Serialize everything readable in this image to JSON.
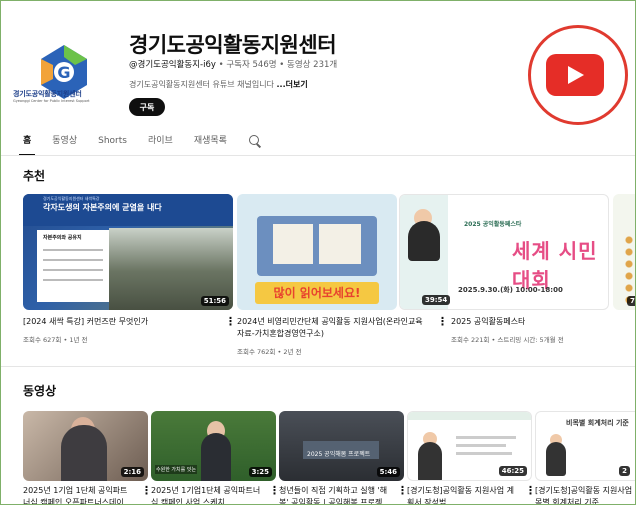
{
  "channel": {
    "logo_label": "경기도공익활동지원센터",
    "logo_sub": "Gyeonggi Center for Public Interest Support",
    "title": "경기도공익활동지원센터",
    "handle": "@경기도공익활동지-i6y",
    "subscribers": "구독자 546명",
    "videos": "동영상 231개",
    "description": "경기도공익활동지원센터 유튜브 채널입니다",
    "more_label": "...더보기",
    "subscribe_label": "구독"
  },
  "tabs": [
    {
      "label": "홈",
      "active": true
    },
    {
      "label": "동영상"
    },
    {
      "label": "Shorts"
    },
    {
      "label": "라이브"
    },
    {
      "label": "재생목록"
    }
  ],
  "recommended": {
    "title": "추천",
    "videos": [
      {
        "title": "[2024 새싹 특강] 커먼즈란 무엇인가",
        "meta": "조회수 627회 • 1년 전",
        "duration": "51:56",
        "thumb_text": "각자도생의 자본주의에 균열을 내다",
        "slide_text": "자본주의와 공유지"
      },
      {
        "title": "2024년 비영리민간단체 공익활동 지원사업(온라인교육",
        "title2": "자료-가치혼합경영연구소)",
        "meta": "조회수 762회 • 2년 전",
        "duration": "",
        "thumb_text": "많이 읽어보세요!"
      },
      {
        "title": "2025 공익활동페스타",
        "meta": "조회수 221회 • 스트리밍 시간: 5개월 전",
        "duration": "39:54",
        "thumb_text": "세계 시민대회",
        "thumb_date": "2025.9.30.(화) 10:00-18:00",
        "thumb_small": "2025 공익활동페스타"
      },
      {
        "title": "",
        "meta": "",
        "duration": "7:"
      }
    ]
  },
  "videos_section": {
    "title": "동영상",
    "videos": [
      {
        "title": "2025년 1기업 1단체 공익파트",
        "title2": "너십 캠페인 오픈파트너스데이...",
        "duration": "2:16"
      },
      {
        "title": "2025년 1기업1단체 공익파트너",
        "title2": "십 캠페인 사업 스케치",
        "duration": "3:25",
        "caption": "수원한 가치를 잇는"
      },
      {
        "title": "청년들이 직접 기획하고 실행 '해",
        "title2": "봄' 공익활동 | 공익해봄 프로젝...",
        "duration": "5:46",
        "caption": "2025 공익해봄 프로젝트"
      },
      {
        "title": "[경기도청]공익활동 지원사업 계",
        "title2": "획서 작성법",
        "duration": "46:25"
      },
      {
        "title": "[경기도청]공익활동 지원사업 비",
        "title2": "목별 회계처리 기준",
        "duration": "2",
        "caption": "비목별 회계처리 기준"
      }
    ]
  },
  "colors": {
    "youtube_red": "#e52d27",
    "circle_red": "#e03a2f",
    "frame_green": "#7fb069"
  }
}
